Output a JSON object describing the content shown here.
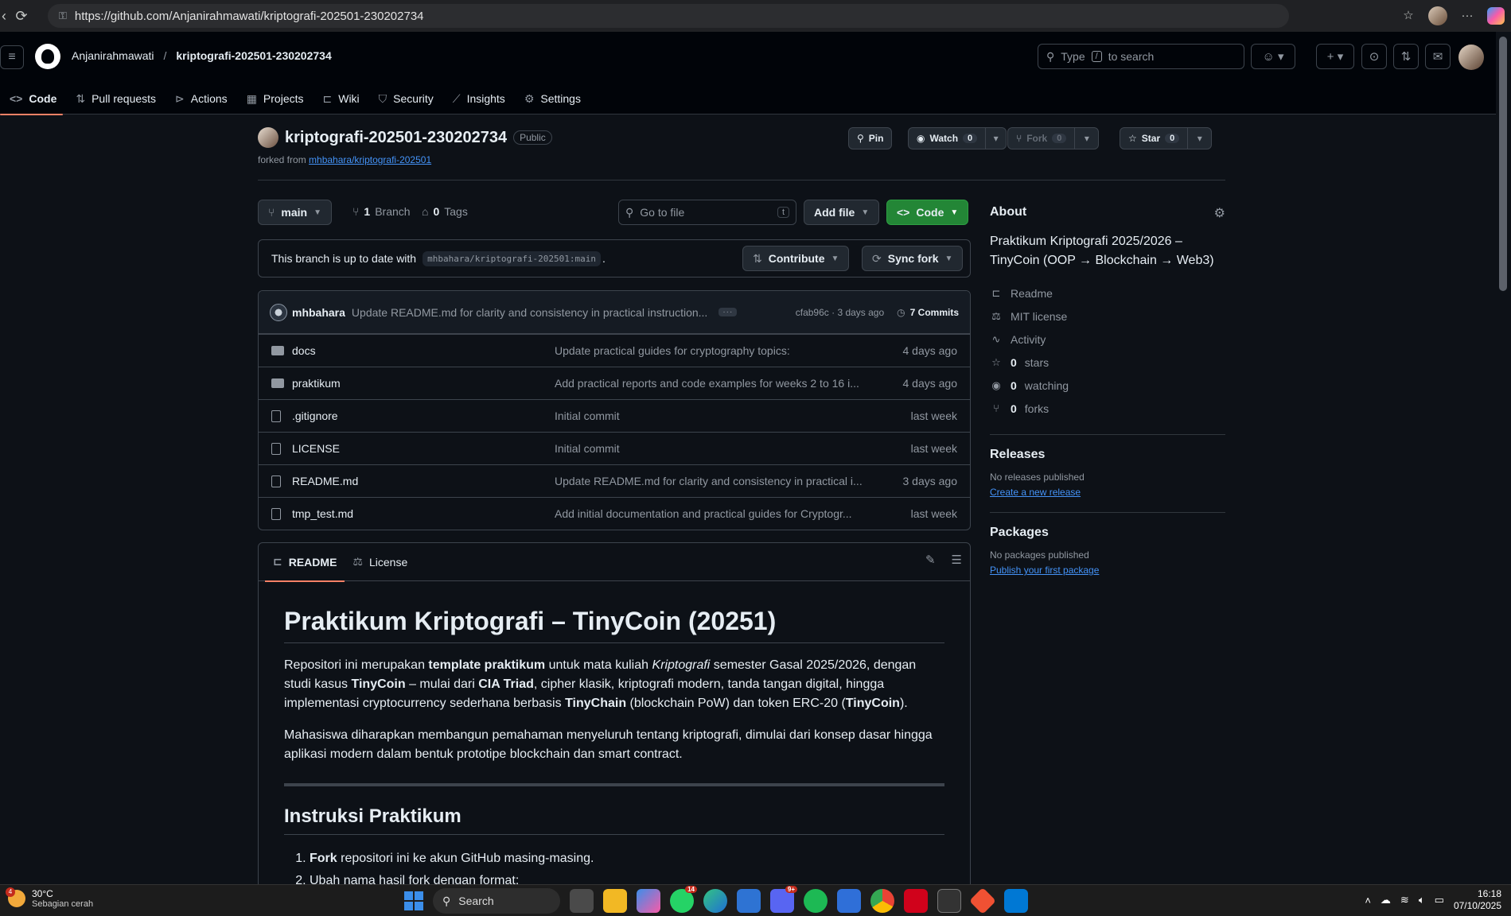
{
  "browser": {
    "url": "https://github.com/Anjanirahmawati/kriptografi-202501-230202734"
  },
  "header": {
    "owner": "Anjanirahmawati",
    "separator": "/",
    "repo": "kriptografi-202501-230202734",
    "search_placeholder_prefix": "Type",
    "search_key": "/",
    "search_placeholder_suffix": "to search"
  },
  "tabs": [
    {
      "label": "Code",
      "icon": "code-icon"
    },
    {
      "label": "Pull requests",
      "icon": "pull-request-icon"
    },
    {
      "label": "Actions",
      "icon": "play-icon"
    },
    {
      "label": "Projects",
      "icon": "table-icon"
    },
    {
      "label": "Wiki",
      "icon": "book-icon"
    },
    {
      "label": "Security",
      "icon": "shield-icon"
    },
    {
      "label": "Insights",
      "icon": "graph-icon"
    },
    {
      "label": "Settings",
      "icon": "gear-icon"
    }
  ],
  "repo": {
    "name": "kriptografi-202501-230202734",
    "visibility": "Public",
    "forked_prefix": "forked from",
    "forked_from": "mhbahara/kriptografi-202501",
    "pin_label": "Pin",
    "watch_label": "Watch",
    "watch_count": "0",
    "fork_label": "Fork",
    "fork_count": "0",
    "star_label": "Star",
    "star_count": "0"
  },
  "toolbar": {
    "branch": "main",
    "branch_count": "1",
    "branch_label": "Branch",
    "tag_count": "0",
    "tag_label": "Tags",
    "goto_placeholder": "Go to file",
    "goto_key": "t",
    "add_file": "Add file",
    "code": "Code"
  },
  "branch_status": {
    "text": "This branch is up to date with",
    "ref": "mhbahara/kriptografi-202501:main",
    "period": ".",
    "contribute": "Contribute",
    "sync": "Sync fork"
  },
  "commit": {
    "author": "mhbahara",
    "message": "Update README.md for clarity and consistency in practical instruction...",
    "hash_date": "cfab96c · 3 days ago",
    "commits": "7 Commits"
  },
  "files": [
    {
      "type": "folder",
      "name": "docs",
      "message": "Update practical guides for cryptography topics:",
      "date": "4 days ago"
    },
    {
      "type": "folder",
      "name": "praktikum",
      "message": "Add practical reports and code examples for weeks 2 to 16 i...",
      "date": "4 days ago"
    },
    {
      "type": "file",
      "name": ".gitignore",
      "message": "Initial commit",
      "date": "last week"
    },
    {
      "type": "file",
      "name": "LICENSE",
      "message": "Initial commit",
      "date": "last week"
    },
    {
      "type": "file",
      "name": "README.md",
      "message": "Update README.md for clarity and consistency in practical i...",
      "date": "3 days ago"
    },
    {
      "type": "file",
      "name": "tmp_test.md",
      "message": "Add initial documentation and practical guides for Cryptogr...",
      "date": "last week"
    }
  ],
  "readme": {
    "tab_readme": "README",
    "tab_license": "License",
    "title": "Praktikum Kriptografi – TinyCoin (20251)",
    "p1": {
      "a": "Repositori ini merupakan ",
      "b": "template praktikum",
      "c": " untuk mata kuliah ",
      "d": "Kriptografi",
      "e": " semester Gasal 2025/2026, dengan studi kasus ",
      "f": "TinyCoin",
      "g": " – mulai dari ",
      "h": "CIA Triad",
      "i": ", cipher klasik, kriptografi modern, tanda tangan digital, hingga implementasi cryptocurrency sederhana berbasis ",
      "j": "TinyChain",
      "k": " (blockchain PoW) dan token ERC-20 (",
      "l": "TinyCoin",
      "m": ")."
    },
    "p2": "Mahasiswa diharapkan membangun pemahaman menyeluruh tentang kriptografi, dimulai dari konsep dasar hingga aplikasi modern dalam bentuk prototipe blockchain dan smart contract.",
    "h2": "Instruksi Praktikum",
    "step1_bold": "Fork",
    "step1_rest": " repositori ini ke akun GitHub masing-masing.",
    "step2": "Ubah nama hasil fork dengan format:"
  },
  "about": {
    "title": "About",
    "description": "Praktikum Kriptografi 2025/2026 – TinyCoin (OOP → Blockchain → Web3)",
    "readme": "Readme",
    "license": "MIT license",
    "activity": "Activity",
    "stars_count": "0",
    "stars": "stars",
    "watching_count": "0",
    "watching": "watching",
    "forks_count": "0",
    "forks": "forks"
  },
  "releases": {
    "title": "Releases",
    "note": "No releases published",
    "link": "Create a new release"
  },
  "packages": {
    "title": "Packages",
    "note": "No packages published",
    "link": "Publish your first package"
  },
  "taskbar": {
    "weather_badge": "4",
    "temp": "30°C",
    "condition": "Sebagian cerah",
    "search": "Search",
    "whatsapp_badge": "14",
    "discord_badge": "9+",
    "time": "16:18",
    "date": "07/10/2025"
  },
  "colors": {
    "bg": "#0d1117",
    "header_bg": "#010409",
    "accent_tab": "#f78166",
    "link": "#4493f8",
    "green": "#238636"
  }
}
